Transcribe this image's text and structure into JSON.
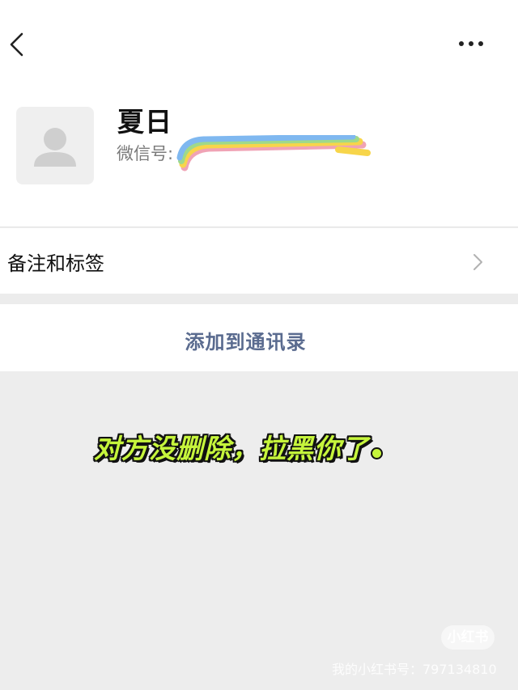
{
  "nav": {
    "back_icon": "chevron-left-icon",
    "more_icon": "more-dots-icon"
  },
  "profile": {
    "name": "夏日",
    "wechat_id_label": "微信号:"
  },
  "remark": {
    "label": "备注和标签"
  },
  "actions": {
    "add_contact": "添加到通讯录"
  },
  "overlay": {
    "caption": "对方没删除，拉黑你了",
    "caption_color": "#c6f53c"
  },
  "watermark": {
    "badge": "小红书",
    "text": "我的小红书号：797134810"
  },
  "colors": {
    "link": "#5a6b8f",
    "background": "#ededed"
  }
}
